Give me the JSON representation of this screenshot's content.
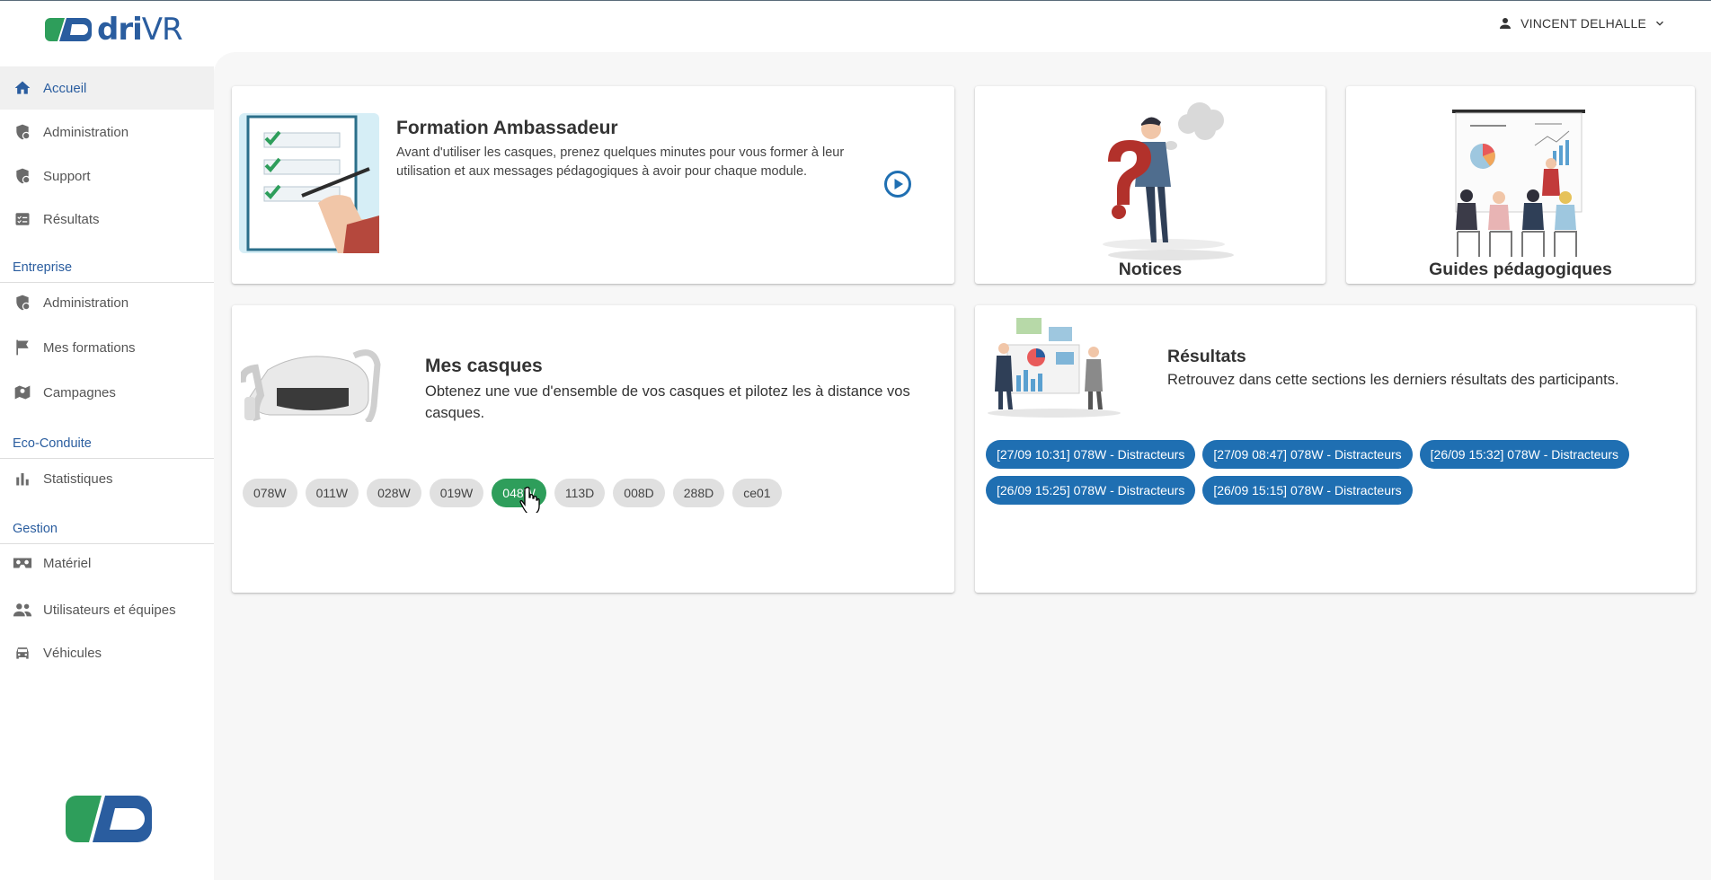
{
  "app": {
    "logo_text_a": "dri",
    "logo_text_b": "VR"
  },
  "header": {
    "user_name": "VINCENT DELHALLE"
  },
  "sidebar": {
    "top_items": [
      {
        "label": "Accueil",
        "icon": "home-icon",
        "active": true
      },
      {
        "label": "Administration",
        "icon": "shield-gear-icon"
      },
      {
        "label": "Support",
        "icon": "shield-gear-icon"
      },
      {
        "label": "Résultats",
        "icon": "checklist-icon"
      }
    ],
    "sections": [
      {
        "title": "Entreprise",
        "items": [
          {
            "label": "Administration",
            "icon": "shield-gear-icon"
          },
          {
            "label": "Mes formations",
            "icon": "flag-icon"
          },
          {
            "label": "Campagnes",
            "icon": "map-pin-icon"
          }
        ]
      },
      {
        "title": "Eco-Conduite",
        "items": [
          {
            "label": "Statistiques",
            "icon": "bar-chart-icon"
          }
        ]
      },
      {
        "title": "Gestion",
        "items": [
          {
            "label": "Matériel",
            "icon": "vr-headset-icon"
          },
          {
            "label": "Utilisateurs et équipes",
            "icon": "people-icon"
          },
          {
            "label": "Véhicules",
            "icon": "car-icon"
          }
        ]
      }
    ]
  },
  "main": {
    "formation": {
      "title": "Formation Ambassadeur",
      "description": "Avant d'utiliser les casques, prenez quelques minutes pour vous former à leur utilisation et aux messages pédagogiques à avoir pour chaque module."
    },
    "notices": {
      "title": "Notices"
    },
    "guides": {
      "title": "Guides pédagogiques"
    },
    "casques": {
      "title": "Mes casques",
      "description": "Obtenez une vue d'ensemble de vos casques et pilotez les à distance vos casques.",
      "chips": [
        "078W",
        "011W",
        "028W",
        "019W",
        "048W",
        "113D",
        "008D",
        "288D",
        "ce01"
      ],
      "selected_index": 4
    },
    "resultats": {
      "title": "Résultats",
      "description": "Retrouvez dans cette sections les derniers résultats des participants.",
      "chips": [
        "[27/09 10:31] 078W - Distracteurs",
        "[27/09 08:47] 078W - Distracteurs",
        "[26/09 15:32] 078W - Distracteurs",
        "[26/09 15:25] 078W - Distracteurs",
        "[26/09 15:15] 078W - Distracteurs"
      ]
    }
  },
  "colors": {
    "brand_blue": "#2a5d9f",
    "brand_green": "#2e9e5b",
    "chip_blue": "#1f6fb2"
  }
}
